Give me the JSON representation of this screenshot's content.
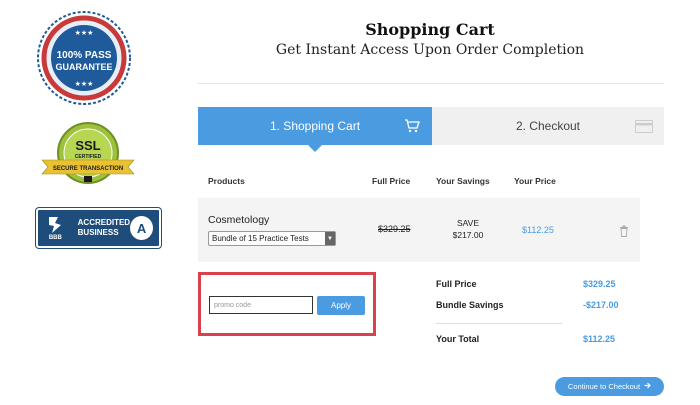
{
  "badges": {
    "pass": {
      "line1": "100% PASS",
      "line2": "GUARANTEE",
      "tm": "™"
    },
    "ssl": {
      "big": "SSL",
      "certified": "CERTIFIED",
      "secure": "SECURE TRANSACTION"
    },
    "bbb": {
      "logo": "BBB",
      "line1": "ACCREDITED",
      "line2": "BUSINESS",
      "rating": "A"
    }
  },
  "header": {
    "title": "Shopping Cart",
    "subtitle": "Get Instant Access Upon Order Completion"
  },
  "steps": [
    {
      "label": "1. Shopping Cart",
      "icon": "cart-icon"
    },
    {
      "label": "2. Checkout",
      "icon": "credit-card-icon"
    }
  ],
  "table": {
    "headers": {
      "products": "Products",
      "full_price": "Full Price",
      "savings": "Your Savings",
      "your_price": "Your Price"
    },
    "row": {
      "name": "Cosmetology",
      "option": "Bundle of 15 Practice Tests",
      "full_price": "$329.25",
      "save_label": "SAVE",
      "save_amount": "$217.00",
      "your_price": "$112.25"
    }
  },
  "promo": {
    "placeholder": "promo code",
    "apply": "Apply"
  },
  "summary": {
    "full_price_label": "Full Price",
    "full_price": "$329.25",
    "bundle_label": "Bundle Savings",
    "bundle": "-$217.00",
    "total_label": "Your Total",
    "total": "$112.25"
  },
  "checkout_button": "Continue to Checkout",
  "colors": {
    "accent": "#4a9be0",
    "highlight": "#d9424c",
    "bbb": "#1e4d7b"
  }
}
